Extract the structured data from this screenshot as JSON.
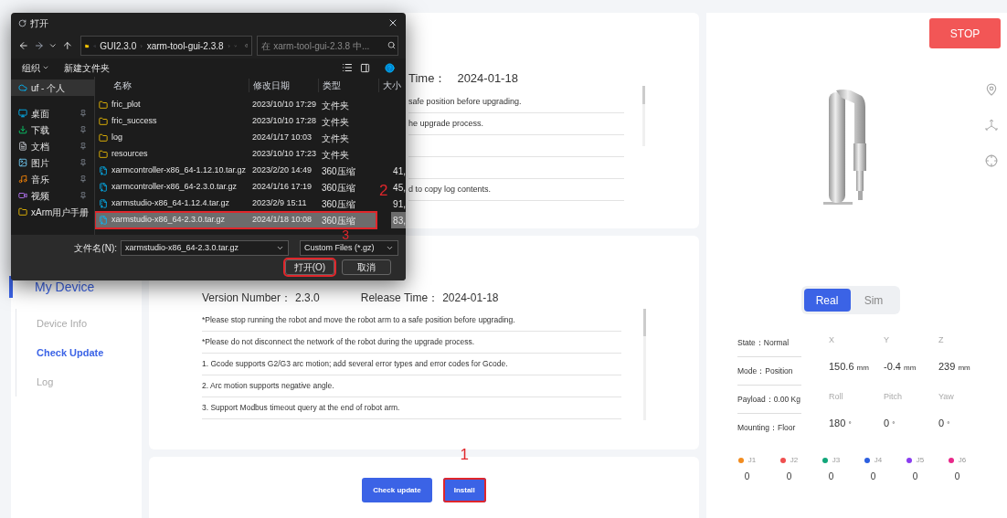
{
  "dialog": {
    "title": "打开",
    "path": [
      "GUI2.3.0",
      "xarm-tool-gui-2.3.8"
    ],
    "search": {
      "placeholder": "在 xarm-tool-gui-2.3.8 中..."
    },
    "toolbar": [
      {
        "label": "组织",
        "dropdown": true
      },
      {
        "label": "新建文件夹",
        "dropdown": false
      }
    ],
    "nav_items": [
      {
        "label": "uf - 个人",
        "kind": "cloud",
        "selected": true,
        "pinned": false
      },
      {
        "label": "桌面",
        "kind": "desktop",
        "selected": false,
        "pinned": true
      },
      {
        "label": "下载",
        "kind": "download",
        "selected": false,
        "pinned": true
      },
      {
        "label": "文档",
        "kind": "document",
        "selected": false,
        "pinned": true
      },
      {
        "label": "图片",
        "kind": "picture",
        "selected": false,
        "pinned": true
      },
      {
        "label": "音乐",
        "kind": "music",
        "selected": false,
        "pinned": true
      },
      {
        "label": "视频",
        "kind": "video",
        "selected": false,
        "pinned": true
      },
      {
        "label": "xArm用户手册",
        "kind": "folder",
        "selected": false
      }
    ],
    "columns": [
      "名称",
      "修改日期",
      "类型",
      "大小"
    ],
    "files": [
      {
        "name": "fric_plot",
        "modified": "2023/10/10 17:29",
        "type": "文件夹",
        "kind": "folder",
        "selected": false,
        "annotated": false
      },
      {
        "name": "fric_success",
        "modified": "2023/10/10 17:28",
        "type": "文件夹",
        "kind": "folder",
        "selected": false,
        "annotated": false
      },
      {
        "name": "log",
        "modified": "2024/1/17 10:03",
        "type": "文件夹",
        "kind": "folder",
        "selected": false,
        "annotated": false
      },
      {
        "name": "resources",
        "modified": "2023/10/10 17:23",
        "type": "文件夹",
        "kind": "folder",
        "selected": false,
        "annotated": false
      },
      {
        "name": "xarmcontroller-x86_64-1.12.10.tar.gz",
        "modified": "2023/2/20 14:49",
        "type": "360压缩",
        "size": "41,",
        "kind": "archive",
        "selected": false,
        "annotated": false
      },
      {
        "name": "xarmcontroller-x86_64-2.3.0.tar.gz",
        "modified": "2024/1/16 17:19",
        "type": "360压缩",
        "size": "45,",
        "kind": "archive",
        "selected": false,
        "annotated": false
      },
      {
        "name": "xarmstudio-x86_64-1.12.4.tar.gz",
        "modified": "2023/2/9 15:11",
        "type": "360压缩",
        "size": "91,",
        "kind": "archive",
        "selected": false,
        "annotated": false
      },
      {
        "name": "xarmstudio-x86_64-2.3.0.tar.gz",
        "modified": "2024/1/18 10:08",
        "type": "360压缩",
        "size": "83,",
        "kind": "archive",
        "selected": true,
        "annotated": true
      }
    ],
    "file_annotation": "2",
    "filename_label": "文件名(N):",
    "filename": "xarmstudio-x86_64-2.3.0.tar.gz",
    "filter": "Custom Files (*.gz)",
    "filter_annotation": "3",
    "buttons": [
      {
        "label": "打开(O)",
        "annotated": true
      },
      {
        "label": "取消",
        "annotated": false
      }
    ]
  },
  "sidebar": {
    "title": "My Device",
    "items": [
      {
        "label": "Device Info",
        "selected": false
      },
      {
        "label": "Check Update",
        "selected": true
      },
      {
        "label": "Log",
        "selected": false
      }
    ]
  },
  "upper_card": {
    "release_label": "Time：",
    "release_value": "2024-01-18",
    "notes": [
      "safe position before upgrading.",
      "he upgrade process.",
      "d to copy log contents."
    ]
  },
  "lower_card": {
    "version_label": "Version Number：",
    "version_value": "2.3.0",
    "release_label": "Release Time：",
    "release_value": "2024-01-18",
    "notes": [
      "*Please stop running the robot and move the robot arm to a safe position before upgrading.",
      "*Please do not disconnect the network of the robot during the upgrade process.",
      "1. Gcode supports G2/G3 arc motion; add several error types and error codes for Gcode.",
      "2. Arc motion supports negative angle.",
      "3. Support Modbus timeout query at the end of robot arm."
    ]
  },
  "update_actions": {
    "buttons": [
      {
        "label": "Check update",
        "annotated": false
      },
      {
        "label": "Install",
        "annotated": true
      }
    ],
    "annotation": "1"
  },
  "robot_panel": {
    "stop": "STOP",
    "modes": [
      {
        "label": "Real",
        "selected": true
      },
      {
        "label": "Sim",
        "selected": false
      }
    ],
    "status": [
      "State：Normal",
      "Mode：Position",
      "Payload：0.00 Kg",
      "Mounting：Floor"
    ],
    "coords": [
      {
        "label": "X",
        "value": "150.6",
        "unit": "mm"
      },
      {
        "label": "Y",
        "value": "-0.4",
        "unit": "mm"
      },
      {
        "label": "Z",
        "value": "239",
        "unit": "mm"
      },
      {
        "label": "Roll",
        "value": "180",
        "unit": "°"
      },
      {
        "label": "Pitch",
        "value": "0",
        "unit": "°"
      },
      {
        "label": "Yaw",
        "value": "0",
        "unit": "°"
      }
    ],
    "joints": [
      {
        "label": "J1",
        "value": "0",
        "color": "#f28c1f"
      },
      {
        "label": "J2",
        "value": "0",
        "color": "#ef4f4f"
      },
      {
        "label": "J3",
        "value": "0",
        "color": "#11a67a"
      },
      {
        "label": "J4",
        "value": "0",
        "color": "#2c5fe0"
      },
      {
        "label": "J5",
        "value": "0",
        "color": "#8a3cf0"
      },
      {
        "label": "J6",
        "value": "0",
        "color": "#e8288a"
      }
    ]
  }
}
